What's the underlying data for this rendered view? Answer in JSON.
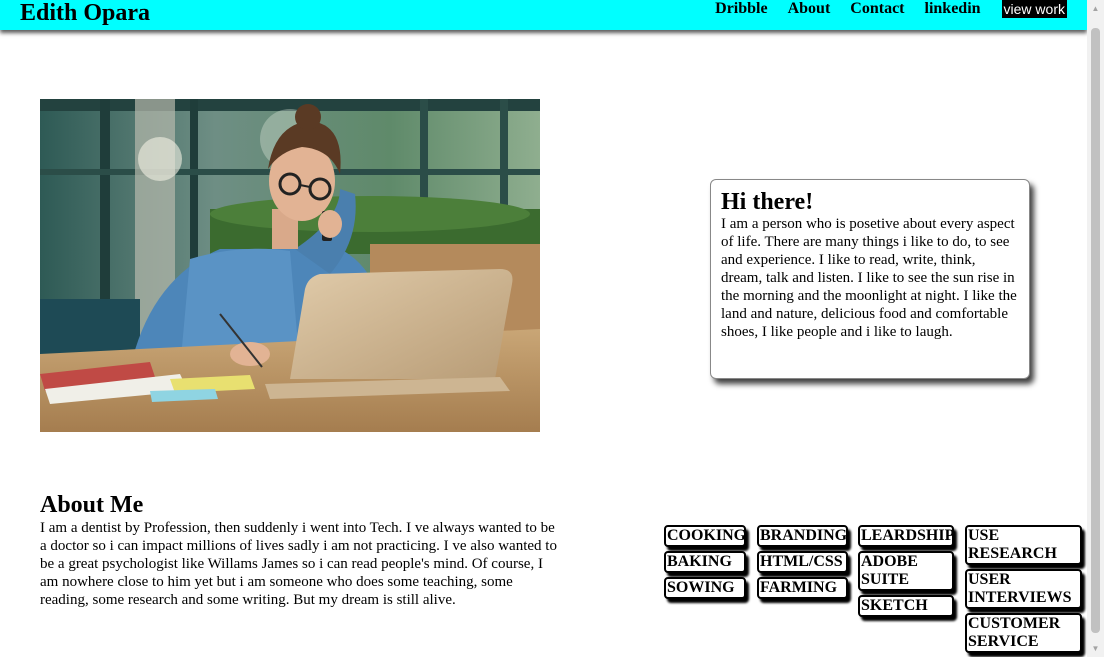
{
  "header": {
    "brand": "Edith Opara",
    "nav": [
      "Dribble",
      "About",
      "Contact",
      "linkedin"
    ],
    "cta": "view work",
    "background_color": "#00ffff"
  },
  "hero": {
    "image_alt": "woman working at laptop while on phone"
  },
  "intro": {
    "title": "Hi there!",
    "text": "I am a person who is posetive about every aspect of life. There are many things i like to do, to see and experience. I like to read, write, think, dream, talk and listen. I like to see the sun rise in the morning and the moonlight at night. I like the land and nature, delicious food and comfortable shoes, I like people and i like to laugh."
  },
  "about": {
    "title": "About Me",
    "text": "I am a dentist by Profession, then suddenly i went into Tech. I ve always wanted to be a doctor so i can impact millions of lives sadly i am not practicing. I ve also wanted to be a great psychologist like Willams James so i can read people's mind. Of course, I am nowhere close to him yet but i am someone who does some teaching, some reading, some research and some writing. But my dream is still alive."
  },
  "skills": [
    "COOKING",
    "BAKING",
    "SOWING",
    "BRANDING",
    "HTML/CSS",
    "FARMING",
    "LEARDSHIP",
    "ADOBE SUITE",
    "SKETCH",
    "USE RESEARCH",
    "USER INTERVIEWS",
    "CUSTOMER SERVICE"
  ]
}
